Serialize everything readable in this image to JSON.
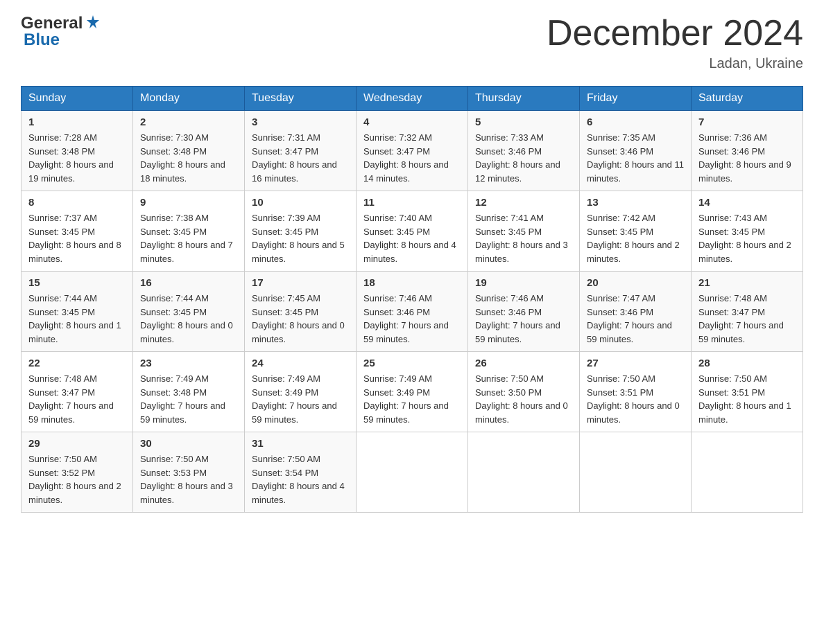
{
  "header": {
    "logo_general": "General",
    "logo_blue": "Blue",
    "month_title": "December 2024",
    "location": "Ladan, Ukraine"
  },
  "weekdays": [
    "Sunday",
    "Monday",
    "Tuesday",
    "Wednesday",
    "Thursday",
    "Friday",
    "Saturday"
  ],
  "weeks": [
    [
      {
        "day": "1",
        "sunrise": "7:28 AM",
        "sunset": "3:48 PM",
        "daylight": "8 hours and 19 minutes."
      },
      {
        "day": "2",
        "sunrise": "7:30 AM",
        "sunset": "3:48 PM",
        "daylight": "8 hours and 18 minutes."
      },
      {
        "day": "3",
        "sunrise": "7:31 AM",
        "sunset": "3:47 PM",
        "daylight": "8 hours and 16 minutes."
      },
      {
        "day": "4",
        "sunrise": "7:32 AM",
        "sunset": "3:47 PM",
        "daylight": "8 hours and 14 minutes."
      },
      {
        "day": "5",
        "sunrise": "7:33 AM",
        "sunset": "3:46 PM",
        "daylight": "8 hours and 12 minutes."
      },
      {
        "day": "6",
        "sunrise": "7:35 AM",
        "sunset": "3:46 PM",
        "daylight": "8 hours and 11 minutes."
      },
      {
        "day": "7",
        "sunrise": "7:36 AM",
        "sunset": "3:46 PM",
        "daylight": "8 hours and 9 minutes."
      }
    ],
    [
      {
        "day": "8",
        "sunrise": "7:37 AM",
        "sunset": "3:45 PM",
        "daylight": "8 hours and 8 minutes."
      },
      {
        "day": "9",
        "sunrise": "7:38 AM",
        "sunset": "3:45 PM",
        "daylight": "8 hours and 7 minutes."
      },
      {
        "day": "10",
        "sunrise": "7:39 AM",
        "sunset": "3:45 PM",
        "daylight": "8 hours and 5 minutes."
      },
      {
        "day": "11",
        "sunrise": "7:40 AM",
        "sunset": "3:45 PM",
        "daylight": "8 hours and 4 minutes."
      },
      {
        "day": "12",
        "sunrise": "7:41 AM",
        "sunset": "3:45 PM",
        "daylight": "8 hours and 3 minutes."
      },
      {
        "day": "13",
        "sunrise": "7:42 AM",
        "sunset": "3:45 PM",
        "daylight": "8 hours and 2 minutes."
      },
      {
        "day": "14",
        "sunrise": "7:43 AM",
        "sunset": "3:45 PM",
        "daylight": "8 hours and 2 minutes."
      }
    ],
    [
      {
        "day": "15",
        "sunrise": "7:44 AM",
        "sunset": "3:45 PM",
        "daylight": "8 hours and 1 minute."
      },
      {
        "day": "16",
        "sunrise": "7:44 AM",
        "sunset": "3:45 PM",
        "daylight": "8 hours and 0 minutes."
      },
      {
        "day": "17",
        "sunrise": "7:45 AM",
        "sunset": "3:45 PM",
        "daylight": "8 hours and 0 minutes."
      },
      {
        "day": "18",
        "sunrise": "7:46 AM",
        "sunset": "3:46 PM",
        "daylight": "7 hours and 59 minutes."
      },
      {
        "day": "19",
        "sunrise": "7:46 AM",
        "sunset": "3:46 PM",
        "daylight": "7 hours and 59 minutes."
      },
      {
        "day": "20",
        "sunrise": "7:47 AM",
        "sunset": "3:46 PM",
        "daylight": "7 hours and 59 minutes."
      },
      {
        "day": "21",
        "sunrise": "7:48 AM",
        "sunset": "3:47 PM",
        "daylight": "7 hours and 59 minutes."
      }
    ],
    [
      {
        "day": "22",
        "sunrise": "7:48 AM",
        "sunset": "3:47 PM",
        "daylight": "7 hours and 59 minutes."
      },
      {
        "day": "23",
        "sunrise": "7:49 AM",
        "sunset": "3:48 PM",
        "daylight": "7 hours and 59 minutes."
      },
      {
        "day": "24",
        "sunrise": "7:49 AM",
        "sunset": "3:49 PM",
        "daylight": "7 hours and 59 minutes."
      },
      {
        "day": "25",
        "sunrise": "7:49 AM",
        "sunset": "3:49 PM",
        "daylight": "7 hours and 59 minutes."
      },
      {
        "day": "26",
        "sunrise": "7:50 AM",
        "sunset": "3:50 PM",
        "daylight": "8 hours and 0 minutes."
      },
      {
        "day": "27",
        "sunrise": "7:50 AM",
        "sunset": "3:51 PM",
        "daylight": "8 hours and 0 minutes."
      },
      {
        "day": "28",
        "sunrise": "7:50 AM",
        "sunset": "3:51 PM",
        "daylight": "8 hours and 1 minute."
      }
    ],
    [
      {
        "day": "29",
        "sunrise": "7:50 AM",
        "sunset": "3:52 PM",
        "daylight": "8 hours and 2 minutes."
      },
      {
        "day": "30",
        "sunrise": "7:50 AM",
        "sunset": "3:53 PM",
        "daylight": "8 hours and 3 minutes."
      },
      {
        "day": "31",
        "sunrise": "7:50 AM",
        "sunset": "3:54 PM",
        "daylight": "8 hours and 4 minutes."
      },
      null,
      null,
      null,
      null
    ]
  ]
}
